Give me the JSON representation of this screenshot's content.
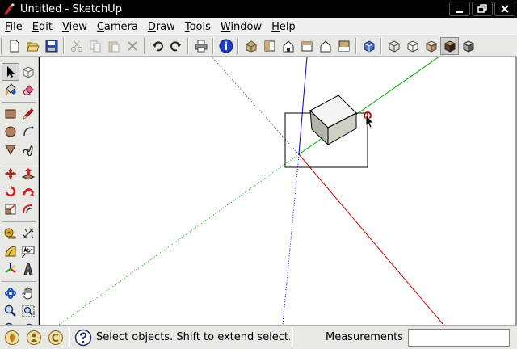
{
  "window": {
    "title": "Untitled - SketchUp"
  },
  "menubar": {
    "items": [
      {
        "label": "File",
        "underline": "F",
        "rest": "ile"
      },
      {
        "label": "Edit",
        "underline": "E",
        "rest": "dit"
      },
      {
        "label": "View",
        "underline": "V",
        "rest": "iew"
      },
      {
        "label": "Camera",
        "underline": "C",
        "rest": "amera"
      },
      {
        "label": "Draw",
        "underline": "D",
        "rest": "raw"
      },
      {
        "label": "Tools",
        "underline": "T",
        "rest": "ools"
      },
      {
        "label": "Window",
        "underline": "W",
        "rest": "indow"
      },
      {
        "label": "Help",
        "underline": "H",
        "rest": "elp"
      }
    ]
  },
  "toolbar": {
    "buttons": [
      "new-icon",
      "open-icon",
      "save-icon",
      "cut-icon",
      "copy-icon",
      "paste-icon",
      "erase-icon",
      "undo-icon",
      "redo-icon",
      "print-icon",
      "model-info-icon",
      "iso-view-icon",
      "top-view-icon",
      "front-view-icon",
      "right-view-icon",
      "back-view-icon",
      "left-view-icon",
      "xray-icon",
      "wireframe-icon",
      "hidden-line-icon",
      "shaded-icon",
      "shaded-textures-icon",
      "monochrome-icon"
    ]
  },
  "status": {
    "message": "Select objects. Shift to extend select. D",
    "measurements_label": "Measurements",
    "measurements_value": ""
  },
  "colors": {
    "axis_red": "#cc0000",
    "axis_green": "#00aa00",
    "axis_blue": "#0000cc",
    "box_top": "#f4f4f4",
    "box_left": "#b4b4aa",
    "box_right": "#cfcfc4"
  }
}
